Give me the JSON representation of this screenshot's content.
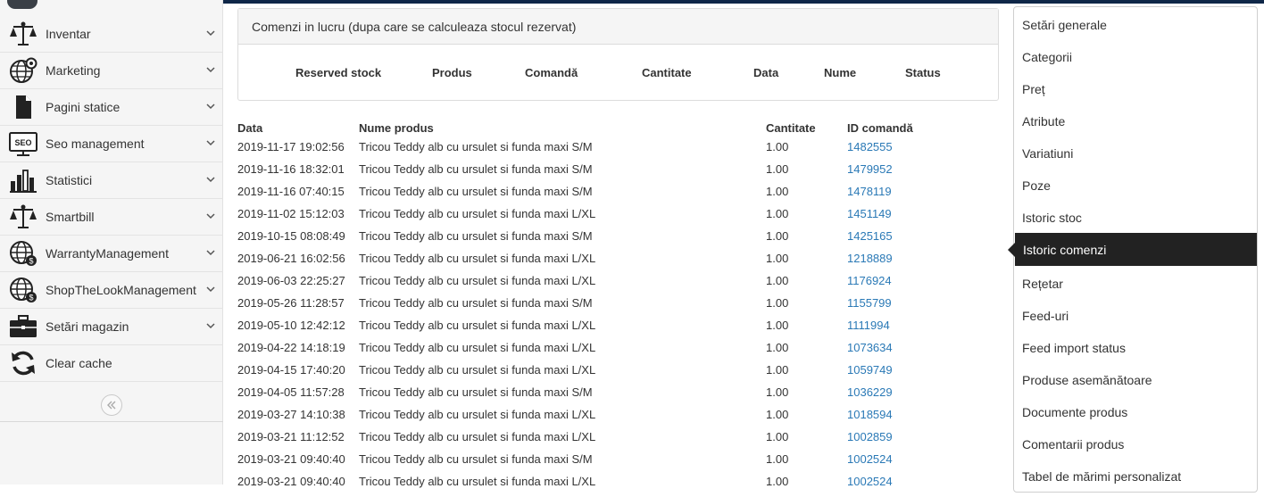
{
  "sidebar": {
    "items": [
      {
        "label": "Inventar",
        "icon": "scale-icon"
      },
      {
        "label": "Marketing",
        "icon": "globe-gear-icon"
      },
      {
        "label": "Pagini statice",
        "icon": "document-icon"
      },
      {
        "label": "Seo management",
        "icon": "seo-monitor-icon"
      },
      {
        "label": "Statistici",
        "icon": "bar-chart-icon"
      },
      {
        "label": "Smartbill",
        "icon": "scale-icon"
      },
      {
        "label": "WarrantyManagement",
        "icon": "globe-dollar-icon"
      },
      {
        "label": "ShopTheLookManagement",
        "icon": "globe-dollar-icon"
      },
      {
        "label": "Setări magazin",
        "icon": "briefcase-icon"
      },
      {
        "label": "Clear cache",
        "icon": "refresh-icon"
      }
    ],
    "seo_badge": "SEO"
  },
  "panel": {
    "title": "Comenzi in lucru (dupa care se calculeaza stocul rezervat)",
    "columns": [
      "Reserved stock",
      "Produs",
      "Comandă",
      "Cantitate",
      "Data",
      "Nume",
      "Status"
    ]
  },
  "history": {
    "headers": {
      "date": "Data",
      "product": "Nume produs",
      "qty": "Cantitate",
      "order_id": "ID comandă"
    },
    "rows": [
      {
        "date": "2019-11-17 19:02:56",
        "product": "Tricou Teddy alb cu ursulet si funda maxi S/M",
        "qty": "1.00",
        "order_id": "1482555"
      },
      {
        "date": "2019-11-16 18:32:01",
        "product": "Tricou Teddy alb cu ursulet si funda maxi S/M",
        "qty": "1.00",
        "order_id": "1479952"
      },
      {
        "date": "2019-11-16 07:40:15",
        "product": "Tricou Teddy alb cu ursulet si funda maxi S/M",
        "qty": "1.00",
        "order_id": "1478119"
      },
      {
        "date": "2019-11-02 15:12:03",
        "product": "Tricou Teddy alb cu ursulet si funda maxi L/XL",
        "qty": "1.00",
        "order_id": "1451149"
      },
      {
        "date": "2019-10-15 08:08:49",
        "product": "Tricou Teddy alb cu ursulet si funda maxi S/M",
        "qty": "1.00",
        "order_id": "1425165"
      },
      {
        "date": "2019-06-21 16:02:56",
        "product": "Tricou Teddy alb cu ursulet si funda maxi L/XL",
        "qty": "1.00",
        "order_id": "1218889"
      },
      {
        "date": "2019-06-03 22:25:27",
        "product": "Tricou Teddy alb cu ursulet si funda maxi L/XL",
        "qty": "1.00",
        "order_id": "1176924"
      },
      {
        "date": "2019-05-26 11:28:57",
        "product": "Tricou Teddy alb cu ursulet si funda maxi S/M",
        "qty": "1.00",
        "order_id": "1155799"
      },
      {
        "date": "2019-05-10 12:42:12",
        "product": "Tricou Teddy alb cu ursulet si funda maxi L/XL",
        "qty": "1.00",
        "order_id": "1111994"
      },
      {
        "date": "2019-04-22 14:18:19",
        "product": "Tricou Teddy alb cu ursulet si funda maxi L/XL",
        "qty": "1.00",
        "order_id": "1073634"
      },
      {
        "date": "2019-04-15 17:40:20",
        "product": "Tricou Teddy alb cu ursulet si funda maxi L/XL",
        "qty": "1.00",
        "order_id": "1059749"
      },
      {
        "date": "2019-04-05 11:57:28",
        "product": "Tricou Teddy alb cu ursulet si funda maxi S/M",
        "qty": "1.00",
        "order_id": "1036229"
      },
      {
        "date": "2019-03-27 14:10:38",
        "product": "Tricou Teddy alb cu ursulet si funda maxi L/XL",
        "qty": "1.00",
        "order_id": "1018594"
      },
      {
        "date": "2019-03-21 11:12:52",
        "product": "Tricou Teddy alb cu ursulet si funda maxi L/XL",
        "qty": "1.00",
        "order_id": "1002859"
      },
      {
        "date": "2019-03-21 09:40:40",
        "product": "Tricou Teddy alb cu ursulet si funda maxi S/M",
        "qty": "1.00",
        "order_id": "1002524"
      },
      {
        "date": "2019-03-21 09:40:40",
        "product": "Tricou Teddy alb cu ursulet si funda maxi L/XL",
        "qty": "1.00",
        "order_id": "1002524"
      }
    ]
  },
  "right_menu": {
    "items": [
      "Setări generale",
      "Categorii",
      "Preț",
      "Atribute",
      "Variatiuni",
      "Poze",
      "Istoric stoc",
      "Istoric comenzi",
      "Rețetar",
      "Feed-uri",
      "Feed import status",
      "Produse asemănătoare",
      "Documente produs",
      "Comentarii produs",
      "Tabel de mărimi personalizat"
    ],
    "active": "Istoric comenzi"
  },
  "colors": {
    "topbar": "#0f2748",
    "link": "#2a79b6",
    "active_bg": "#222222"
  }
}
